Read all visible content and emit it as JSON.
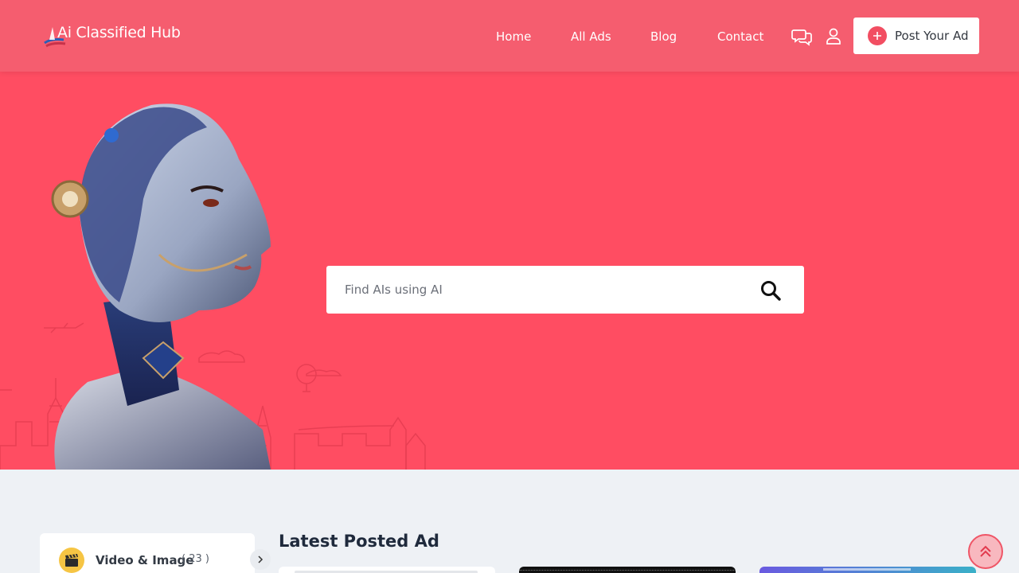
{
  "header": {
    "logo_text": "Ai Classified Hub",
    "nav": [
      "Home",
      "All Ads",
      "Blog",
      "Contact"
    ],
    "icons": {
      "messages": "chat-bubbles-icon",
      "account": "user-icon"
    },
    "post_button": "Post Your Ad"
  },
  "hero": {
    "search_placeholder": "Find AIs using AI",
    "search_icon": "magnifier-icon"
  },
  "sidebar": {
    "category": {
      "name": "Video & Image",
      "count": "( 23 )",
      "icon": "clapperboard-icon"
    }
  },
  "main": {
    "section_title": "Latest Posted Ad"
  },
  "colors": {
    "header_bg": "#f55d6f",
    "hero_bg": "#ff4d62",
    "page_bg": "#eef1f5",
    "accent": "#f24e62"
  }
}
